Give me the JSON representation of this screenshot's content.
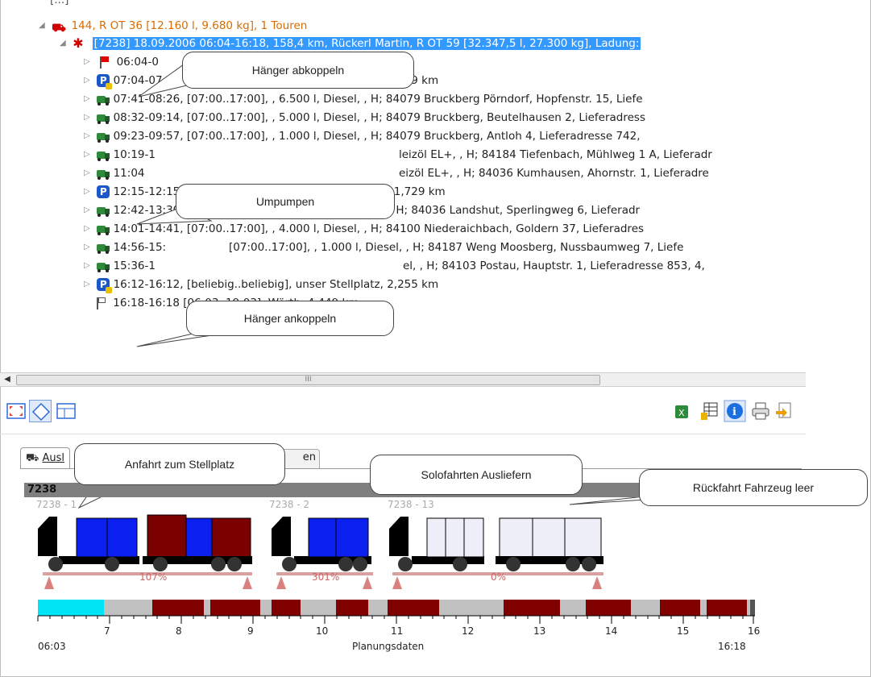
{
  "tree": {
    "top_cut_text": "[...]",
    "tour_row": "144, R OT 36 [12.160 l, 9.680 kg], 1 Touren",
    "selected_row": "[7238] 18.09.2006 06:04-16:18, 158,4 km, Rückerl Martin, R OT 59 [32.347,5 l, 27.300 kg],  Ladung:",
    "rows": [
      {
        "icon": "red-flag-icon",
        "text": "06:04-0"
      },
      {
        "icon": "parking-hitch-icon",
        "text": "07:04-07:04,  [beliebig..beliebig], unser Stellplatz, 4,449 km"
      },
      {
        "icon": "tanker-truck-icon",
        "text": "07:41-08:26,  [07:00..17:00], , 6.500 l, Diesel, , H; 84079 Bruckberg Pörndorf, Hopfenstr. 15, Liefe"
      },
      {
        "icon": "tanker-truck-icon",
        "text": "08:32-09:14,  [07:00..17:00], , 5.000 l, Diesel, , H; 84079 Bruckberg, Beutelhausen 2, Lieferadress"
      },
      {
        "icon": "tanker-truck-icon",
        "text": "09:23-09:57,  [07:00..17:00], , 1.000 l, Diesel, , H; 84079 Bruckberg, Antloh 4, Lieferadresse 742,"
      },
      {
        "icon": "tanker-truck-icon",
        "text": "10:19-1"
      },
      {
        "icon": "tanker-truck-icon",
        "text": "11:04"
      },
      {
        "icon": "parking-icon",
        "text": "12:15-12:15,  [beliebig..beliebig], unser Stellplatz, 21,729 km"
      },
      {
        "icon": "tanker-truck-icon",
        "text": "12:42-13:30,  [07:00..17:00], , 8.000 l, Heizöl EL+, , H; 84036 Landshut, Sperlingweg 6, Lieferadr"
      },
      {
        "icon": "tanker-truck-icon",
        "text": "14:01-14:41,  [07:00..17:00], , 4.000 l, Diesel, , H; 84100 Niederaichbach, Goldern 37, Lieferadres"
      },
      {
        "icon": "tanker-truck-icon",
        "text": "14:56-15:"
      },
      {
        "icon": "tanker-truck-icon",
        "text": "15:36-1"
      },
      {
        "icon": "parking-hitch-icon",
        "text": "16:12-16:12,  [beliebig..beliebig], unser Stellplatz, 2,255 km"
      },
      {
        "icon": "white-flag-icon",
        "text": "16:18-16:18 [06:03..19:03], Wörth, 4,449 km"
      }
    ],
    "partial_texts": {
      "r5": "leizöl EL+, , H; 84184 Tiefenbach, Mühlweg 1 A, Lieferadr",
      "r6": "eizöl EL+, , H; 84036 Kumhausen, Ahornstr. 1, Lieferadre",
      "r10a": "[07:00..17:00], , 1.000 l, Diesel, , H; 84187 Weng Moosberg, Nussbaumweg 7, Liefe",
      "r11": "el, , H; 84103 Postau, Hauptstr. 1, Lieferadresse 853, 4,"
    }
  },
  "callouts": {
    "haenger_ab": "Hänger abkoppeln",
    "umpumpen": "Umpumpen",
    "haenger_an": "Hänger ankoppeln",
    "anfahrt": "Anfahrt zum Stellplatz",
    "solo": "Solofahrten Ausliefern",
    "rueckfahrt": "Rückfahrt Fahrzeug leer"
  },
  "scrollbar": {
    "grip": "III"
  },
  "panel": {
    "tab_label": "Ausl",
    "tab_label_tail": "en",
    "tour_id": "7238",
    "vehicles": [
      {
        "id": "7238 - 1",
        "load_percent": "107%"
      },
      {
        "id": "7238 - 2",
        "load_percent": "301%"
      },
      {
        "id": "7238 - 13",
        "load_percent": "0%"
      }
    ],
    "timeline": {
      "start": "06:03",
      "end": "16:18",
      "caption": "Planungsdaten",
      "hours": [
        "7",
        "8",
        "9",
        "10",
        "11",
        "12",
        "13",
        "14",
        "15",
        "16"
      ]
    }
  },
  "colors": {
    "selection": "#3399ff",
    "tour_orange": "#d96c00",
    "compartment_blue": "#0a1ff0",
    "compartment_red": "#7b0000",
    "compartment_empty": "#eeeef8",
    "timeline_cyan": "#00e5f5",
    "timeline_red": "#800000"
  }
}
